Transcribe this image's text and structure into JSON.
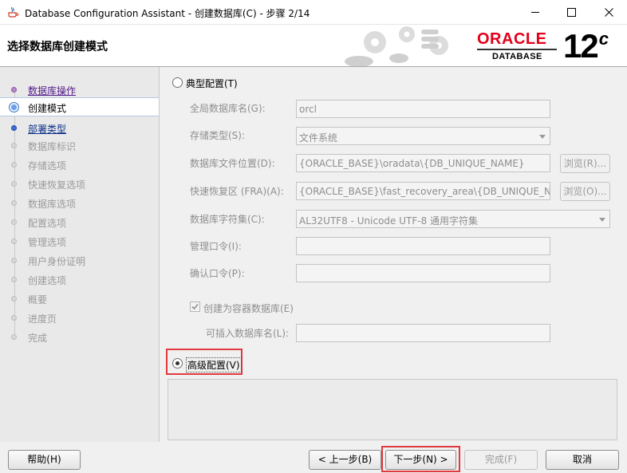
{
  "window": {
    "title": "Database Configuration Assistant - 创建数据库(C) - 步骤 2/14",
    "minimize_glyph": "—",
    "maximize_glyph": "☐",
    "close_glyph": "✕"
  },
  "header": {
    "title": "选择数据库创建模式",
    "brand_word": "ORACLE",
    "brand_sub": "DATABASE",
    "version_number": "12",
    "version_suffix": "c"
  },
  "steps": [
    {
      "label": "数据库操作",
      "state": "done"
    },
    {
      "label": "创建模式",
      "state": "active"
    },
    {
      "label": "部署类型",
      "state": "next"
    },
    {
      "label": "数据库标识",
      "state": "pending"
    },
    {
      "label": "存储选项",
      "state": "pending"
    },
    {
      "label": "快速恢复选项",
      "state": "pending"
    },
    {
      "label": "数据库选项",
      "state": "pending"
    },
    {
      "label": "配置选项",
      "state": "pending"
    },
    {
      "label": "管理选项",
      "state": "pending"
    },
    {
      "label": "用户身份证明",
      "state": "pending"
    },
    {
      "label": "创建选项",
      "state": "pending"
    },
    {
      "label": "概要",
      "state": "pending"
    },
    {
      "label": "进度页",
      "state": "pending"
    },
    {
      "label": "完成",
      "state": "pending"
    }
  ],
  "typical": {
    "label": "典型配置(T)",
    "selected": false,
    "global_db_name_label": "全局数据库名(G):",
    "global_db_name_value": "orcl",
    "storage_type_label": "存储类型(S):",
    "storage_type_value": "文件系统",
    "db_file_location_label": "数据库文件位置(D):",
    "db_file_location_value": "{ORACLE_BASE}\\oradata\\{DB_UNIQUE_NAME}",
    "browse_r_label": "浏览(R)...",
    "fra_label": "快速恢复区 (FRA)(A):",
    "fra_value": "{ORACLE_BASE}\\fast_recovery_area\\{DB_UNIQUE_NAME}",
    "browse_o_label": "浏览(O)...",
    "charset_label": "数据库字符集(C):",
    "charset_value": "AL32UTF8 - Unicode UTF-8 通用字符集",
    "admin_password_label": "管理口令(I):",
    "confirm_password_label": "确认口令(P):",
    "container_db_label": "创建为容器数据库(E)",
    "container_db_checked": true,
    "pdb_name_label": "可插入数据库名(L):"
  },
  "advanced": {
    "label": "高级配置(V)",
    "selected": true
  },
  "buttons": {
    "help": "帮助(H)",
    "back": "< 上一步(B)",
    "next": "下一步(N) >",
    "finish": "完成(F)",
    "cancel": "取消"
  },
  "colors": {
    "brand_red": "#e3001b",
    "highlight_red": "#e0393e"
  }
}
